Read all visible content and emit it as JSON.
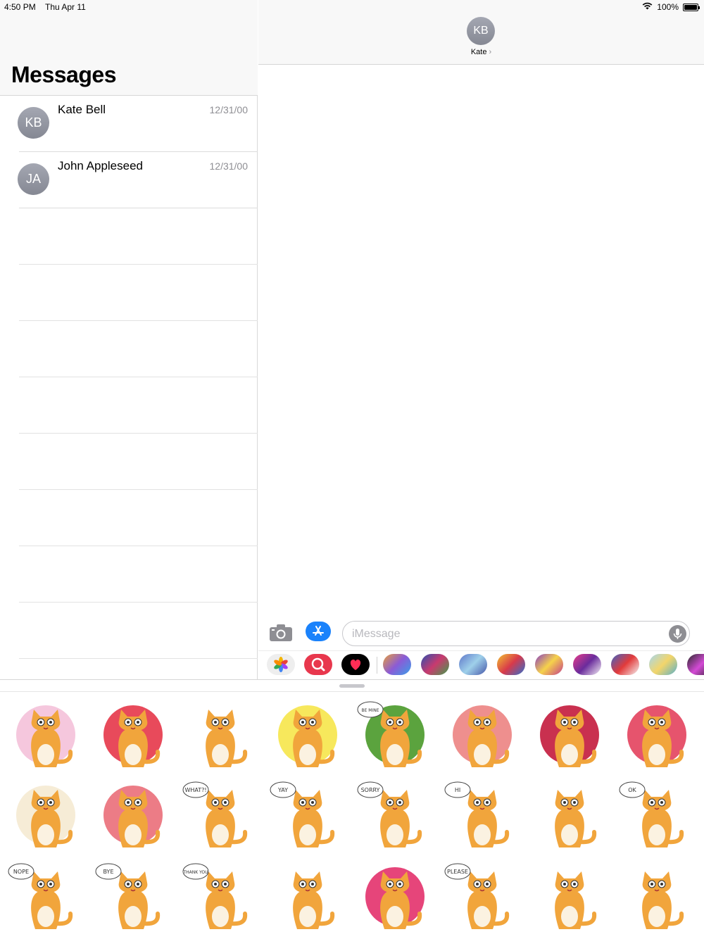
{
  "status_bar": {
    "time": "4:50 PM",
    "date": "Thu Apr 11",
    "battery": "100%",
    "battery_level": 1.0
  },
  "sidebar": {
    "title": "Messages",
    "conversations": [
      {
        "initials": "KB",
        "name": "Kate Bell",
        "date": "12/31/00"
      },
      {
        "initials": "JA",
        "name": "John Appleseed",
        "date": "12/31/00"
      }
    ]
  },
  "conversation": {
    "contact_initials": "KB",
    "contact_name": "Kate",
    "chevron": "›"
  },
  "compose": {
    "placeholder": "iMessage",
    "camera_icon": "camera-icon",
    "appstore_icon": "app-store-icon",
    "mic_icon": "microphone-icon"
  },
  "app_strip": {
    "apps": [
      "photos-app",
      "search-images-app",
      "digital-touch-app",
      "sticker-pack-1",
      "sticker-pack-2",
      "sticker-pack-3",
      "sticker-pack-4",
      "sticker-pack-5",
      "sticker-pack-6",
      "sticker-pack-7",
      "sticker-pack-8",
      "sticker-pack-9"
    ]
  },
  "stickers": {
    "items": [
      {
        "name": "cats-couple-hearts",
        "speech": "",
        "bg": "#f5c7dd"
      },
      {
        "name": "cats-couple-red-hearts",
        "speech": "",
        "bg": "#e84a5b"
      },
      {
        "name": "cats-with-balloon",
        "speech": "",
        "bg": ""
      },
      {
        "name": "cat-sunset-back",
        "speech": "",
        "bg": "#f7e85c"
      },
      {
        "name": "cat-be-mine",
        "speech": "BE MINE",
        "bg": "#5ba33e"
      },
      {
        "name": "cat-blowing-kiss",
        "speech": "",
        "bg": "#ee8f8e"
      },
      {
        "name": "cat-angel",
        "speech": "",
        "bg": "#c9304f"
      },
      {
        "name": "cat-rainbow",
        "speech": "",
        "bg": "#e6546d"
      },
      {
        "name": "cat-happy-circle",
        "speech": "",
        "bg": "#f6ecd6"
      },
      {
        "name": "cat-in-love",
        "speech": "",
        "bg": "#ec7c86"
      },
      {
        "name": "cat-what",
        "speech": "WHAT?!",
        "bg": ""
      },
      {
        "name": "cat-yay",
        "speech": "YAY",
        "bg": ""
      },
      {
        "name": "cat-sorry",
        "speech": "SORRY",
        "bg": ""
      },
      {
        "name": "cat-hi",
        "speech": "HI",
        "bg": ""
      },
      {
        "name": "cat-presentation",
        "speech": "",
        "bg": ""
      },
      {
        "name": "cat-ok",
        "speech": "OK",
        "bg": ""
      },
      {
        "name": "cat-nope",
        "speech": "NOPE",
        "bg": ""
      },
      {
        "name": "cat-bye",
        "speech": "BYE",
        "bg": ""
      },
      {
        "name": "cat-thank-you",
        "speech": "THANK YOU",
        "bg": ""
      },
      {
        "name": "cat-at-desk",
        "speech": "",
        "bg": ""
      },
      {
        "name": "cat-cupid",
        "speech": "",
        "bg": "#e6457a"
      },
      {
        "name": "cat-please",
        "speech": "PLEASE",
        "bg": ""
      },
      {
        "name": "cat-reading-book",
        "speech": "",
        "bg": ""
      },
      {
        "name": "cat-graduate",
        "speech": "",
        "bg": ""
      }
    ]
  }
}
